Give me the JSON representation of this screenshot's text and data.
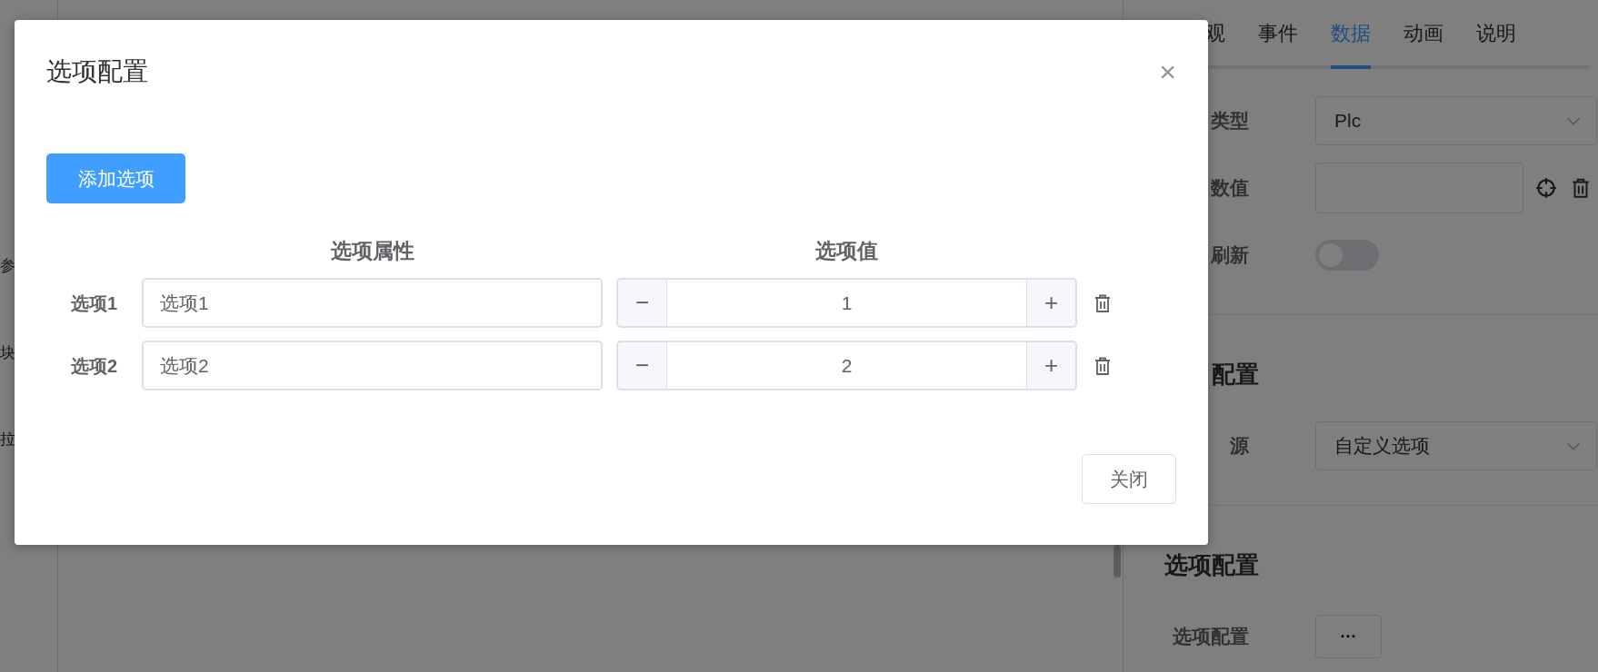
{
  "sidebar": {
    "items": [
      {
        "label": "参"
      },
      {
        "label": "块"
      },
      {
        "label": "拉"
      }
    ]
  },
  "panel": {
    "tabs": [
      {
        "label": "观",
        "selected": false
      },
      {
        "label": "事件",
        "selected": false
      },
      {
        "label": "数据",
        "selected": true
      },
      {
        "label": "动画",
        "selected": false
      },
      {
        "label": "说明",
        "selected": false
      }
    ],
    "sections": [
      {
        "fields": [
          {
            "kind": "select",
            "label": "类型",
            "value": "Plc"
          },
          {
            "kind": "input",
            "label": "数值"
          },
          {
            "kind": "toggle",
            "label": "刷新",
            "on": false
          }
        ]
      },
      {
        "title": "配置",
        "fields": [
          {
            "kind": "select",
            "label": "源",
            "value": "自定义选项"
          }
        ]
      },
      {
        "title": "选项配置",
        "fields": [
          {
            "kind": "more",
            "label": "选项配置",
            "value": "···"
          }
        ]
      }
    ]
  },
  "dialog": {
    "title": "选项配置",
    "close": "×",
    "add_button": "添加选项",
    "columns": [
      "选项属性",
      "选项值"
    ],
    "rows": [
      {
        "label": "选项1",
        "attribute": "选项1",
        "value": "1",
        "minus": "−",
        "plus": "+"
      },
      {
        "label": "选项2",
        "attribute": "选项2",
        "value": "2",
        "minus": "−",
        "plus": "+"
      }
    ],
    "footer_button": "关闭"
  }
}
